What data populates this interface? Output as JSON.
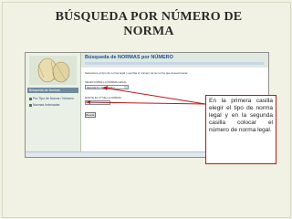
{
  "slide": {
    "title_line1": "BÚSQUEDA POR NÚMERO DE",
    "title_line2": "NORMA",
    "callout_text": "En la primera casilla elegir el tipo de norma legal y en la segunda casilla colocar el número de norma legal.",
    "accent_color": "#c01616"
  },
  "screenshot": {
    "sidebar": {
      "header": "Búsqueda de Normas",
      "links": [
        "Por Tipo de Norma / Número",
        "Normas Indexadas"
      ]
    },
    "page_title": "Búsqueda de NORMAS por NÚMERO",
    "instructions": "Seleccione el tipo de norma legal y escriba el número de la norma que desea buscar",
    "field1_label": "SELECCIONE LA NORMA LEGAL",
    "field1_value": "DECRETO SUPREMO",
    "field2_label": "DIGITE EL Nº DE LA NORMA",
    "submit_label": "Buscar"
  }
}
